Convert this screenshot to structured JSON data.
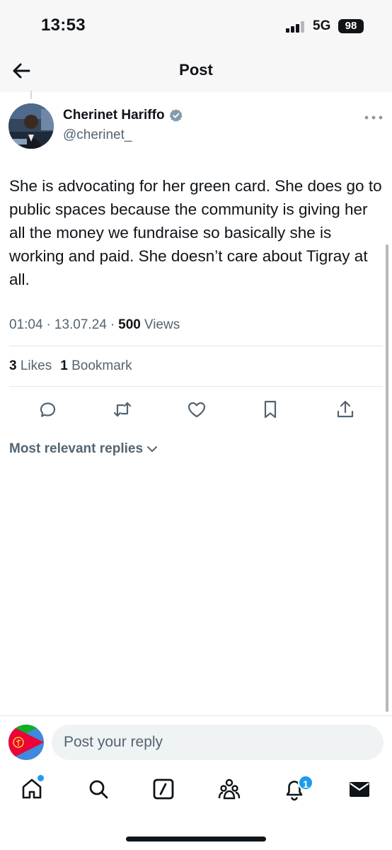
{
  "status_bar": {
    "time": "13:53",
    "network": "5G",
    "battery": "98"
  },
  "header": {
    "title": "Post"
  },
  "post": {
    "author_name": "Cherinet Hariffo",
    "author_handle": "@cherinet_",
    "text": "She is advocating for her green card. She does go to public spaces because the community is giving her all the money we fundraise so basically she is working and paid. She doesn’t care about Tigray at all.",
    "time": "01:04",
    "sep1": "·",
    "date": "13.07.24",
    "sep2": "·",
    "views_count": "500",
    "views_label": "Views",
    "likes_count": "3",
    "likes_label": "Likes",
    "bookmarks_count": "1",
    "bookmarks_label": "Bookmark"
  },
  "replies": {
    "sort_label": "Most relevant replies"
  },
  "reply_bar": {
    "placeholder": "Post your reply"
  },
  "tab_bar": {
    "notifications_badge": "1"
  },
  "colors": {
    "accent": "#1d9bf0",
    "secondary_text": "#536471",
    "primary_text": "#0f1419",
    "verified": "#829aab"
  }
}
